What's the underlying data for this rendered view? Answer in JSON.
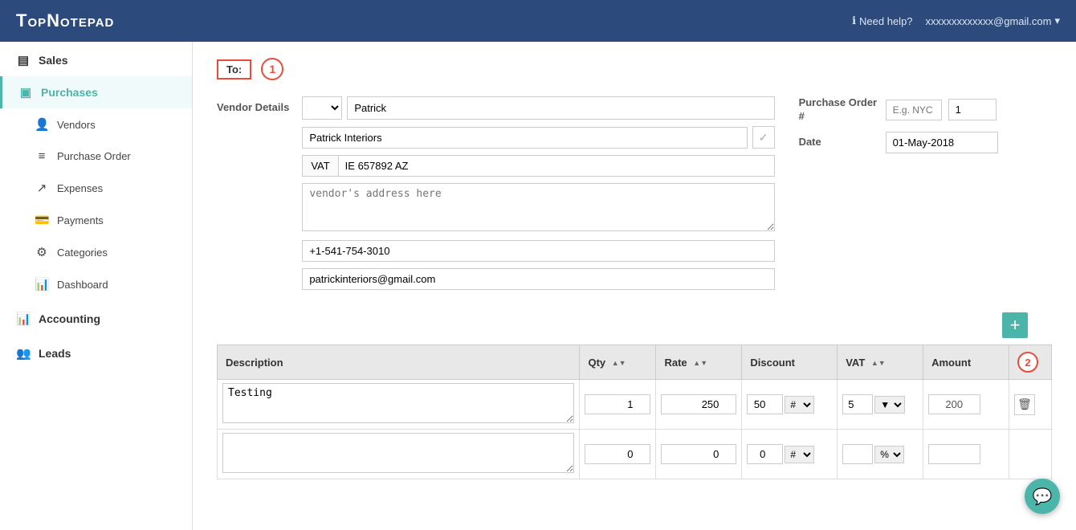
{
  "header": {
    "logo": "TopNotepad",
    "help_label": "Need help?",
    "email": "xxxxxxxxxxxxx@gmail.com"
  },
  "sidebar": {
    "sales_label": "Sales",
    "purchases_label": "Purchases",
    "sub_items": [
      {
        "label": "Vendors",
        "icon": "👤"
      },
      {
        "label": "Purchase Order",
        "icon": "≡"
      },
      {
        "label": "Expenses",
        "icon": "↗"
      },
      {
        "label": "Payments",
        "icon": "💳"
      },
      {
        "label": "Categories",
        "icon": "⚙"
      },
      {
        "label": "Dashboard",
        "icon": "📊"
      }
    ],
    "accounting_label": "Accounting",
    "leads_label": "Leads"
  },
  "form": {
    "to_label": "To:",
    "step1": "1",
    "step2": "2",
    "vendor_details_label": "Vendor Details",
    "vendor_select_placeholder": "▼",
    "vendor_name_value": "Patrick",
    "vendor_company_value": "Patrick Interiors",
    "vat_label": "VAT",
    "vat_number": "IE 657892 AZ",
    "address_placeholder": "vendor's address here",
    "phone": "+1-541-754-3010",
    "email": "patrickinteriors@gmail.com",
    "po_label": "Purchase Order #",
    "date_label": "Date",
    "po_prefix_placeholder": "E.g. NYC",
    "po_number": "1",
    "po_date": "01-May-2018"
  },
  "table": {
    "add_btn": "+",
    "columns": [
      {
        "key": "description",
        "label": "Description"
      },
      {
        "key": "qty",
        "label": "Qty"
      },
      {
        "key": "rate",
        "label": "Rate"
      },
      {
        "key": "discount",
        "label": "Discount"
      },
      {
        "key": "vat",
        "label": "VAT"
      },
      {
        "key": "amount",
        "label": "Amount"
      }
    ],
    "rows": [
      {
        "description": "Testing",
        "qty": "1",
        "rate": "250",
        "discount": "50",
        "discount_type": "#",
        "vat": "5",
        "vat_type": "▼",
        "amount": "200"
      },
      {
        "description": "",
        "qty": "0",
        "rate": "0",
        "discount": "0",
        "discount_type": "#",
        "vat": "",
        "vat_type": "▼",
        "amount": ""
      }
    ]
  }
}
